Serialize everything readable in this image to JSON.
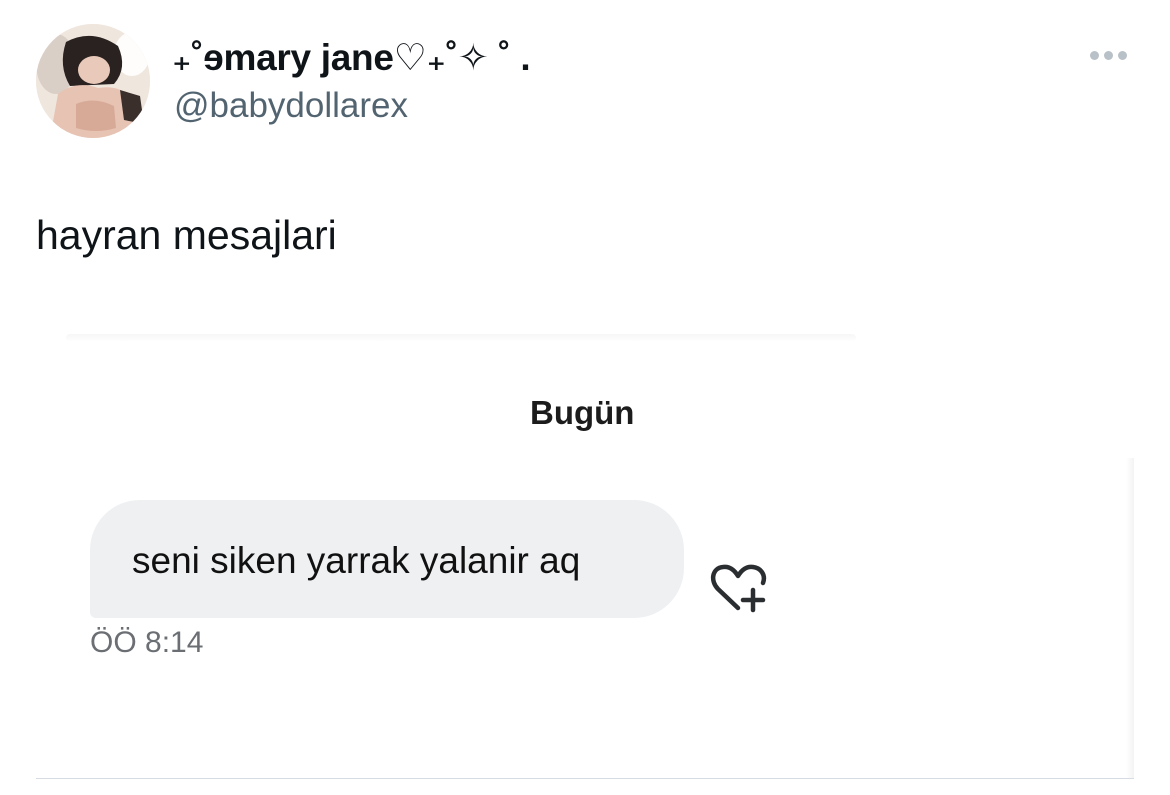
{
  "tweet": {
    "author": {
      "display_name": "₊˚ɘmary jane♡₊˚✧ ˚ .",
      "handle": "@babydollarex"
    },
    "text": "hayran mesajlari",
    "more_icon": "more-horizontal-icon"
  },
  "embedded_dm": {
    "date_label": "Bugün",
    "message_text": "seni siken yarrak yalanir aq",
    "message_time": "ÖÖ 8:14",
    "react_icon": "heart-plus-icon",
    "colors": {
      "bubble": "#eef0f2",
      "time": "#6b6f73"
    }
  },
  "colors": {
    "primary_text": "#0f1419",
    "secondary_text": "#536471",
    "divider": "#d6dce1"
  }
}
